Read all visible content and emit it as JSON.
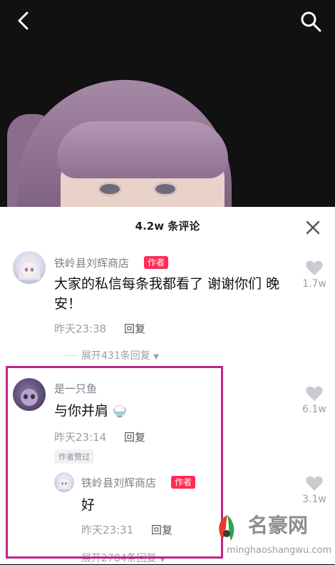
{
  "comments_title": "4.2w 条评论",
  "comments": [
    {
      "username": "铁岭县刘辉商店",
      "author_tag": "作者",
      "text_line1": "大家的私信每条我都看了 谢谢你们 晚",
      "text_line2": "安！",
      "time": "昨天23:38",
      "reply_label": "回复",
      "like_count": "1.7w",
      "expand_label": "展开431条回复"
    },
    {
      "username": "是一只鱼",
      "text": "与你并肩",
      "time": "昨天23:14",
      "reply_label": "回复",
      "like_count": "6.1w",
      "liked_badge": "作者赞过",
      "sub_reply": {
        "username": "铁岭县刘辉商店",
        "author_tag": "作者",
        "text": "好",
        "time": "昨天23:31",
        "reply_label": "回复",
        "like_count": "3.1w"
      },
      "expand_label": "展开2784条回复"
    }
  ],
  "watermark": {
    "name": "名豪网",
    "url": "minghaoshangwu.com"
  },
  "colors": {
    "author_tag": "#ff2c55",
    "highlight_border": "#c0268a"
  }
}
